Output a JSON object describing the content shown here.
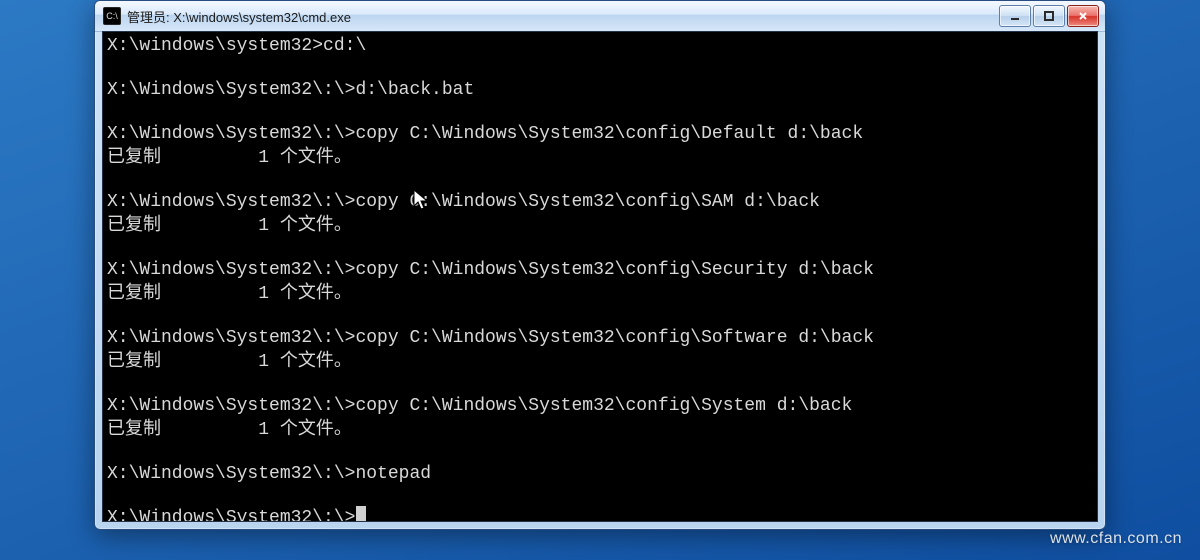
{
  "window": {
    "title": "管理员: X:\\windows\\system32\\cmd.exe",
    "icon_name": "cmd-icon",
    "buttons": {
      "minimize_label": "Minimize",
      "maximize_label": "Maximize",
      "close_label": "Close"
    }
  },
  "terminal": {
    "lines": [
      {
        "cmd": "X:\\windows\\system32>cd:\\",
        "out": ""
      },
      {
        "cmd": "X:\\Windows\\System32\\:\\>d:\\back.bat",
        "out": ""
      },
      {
        "cmd": "X:\\Windows\\System32\\:\\>copy C:\\Windows\\System32\\config\\Default d:\\back",
        "out": "已复制         1 个文件。"
      },
      {
        "cmd": "X:\\Windows\\System32\\:\\>copy C:\\Windows\\System32\\config\\SAM d:\\back",
        "out": "已复制         1 个文件。"
      },
      {
        "cmd": "X:\\Windows\\System32\\:\\>copy C:\\Windows\\System32\\config\\Security d:\\back",
        "out": "已复制         1 个文件。"
      },
      {
        "cmd": "X:\\Windows\\System32\\:\\>copy C:\\Windows\\System32\\config\\Software d:\\back",
        "out": "已复制         1 个文件。"
      },
      {
        "cmd": "X:\\Windows\\System32\\:\\>copy C:\\Windows\\System32\\config\\System d:\\back",
        "out": "已复制         1 个文件。"
      },
      {
        "cmd": "X:\\Windows\\System32\\:\\>notepad",
        "out": ""
      }
    ],
    "prompt": "X:\\Windows\\System32\\:\\>"
  },
  "watermark": "www.cfan.com.cn"
}
